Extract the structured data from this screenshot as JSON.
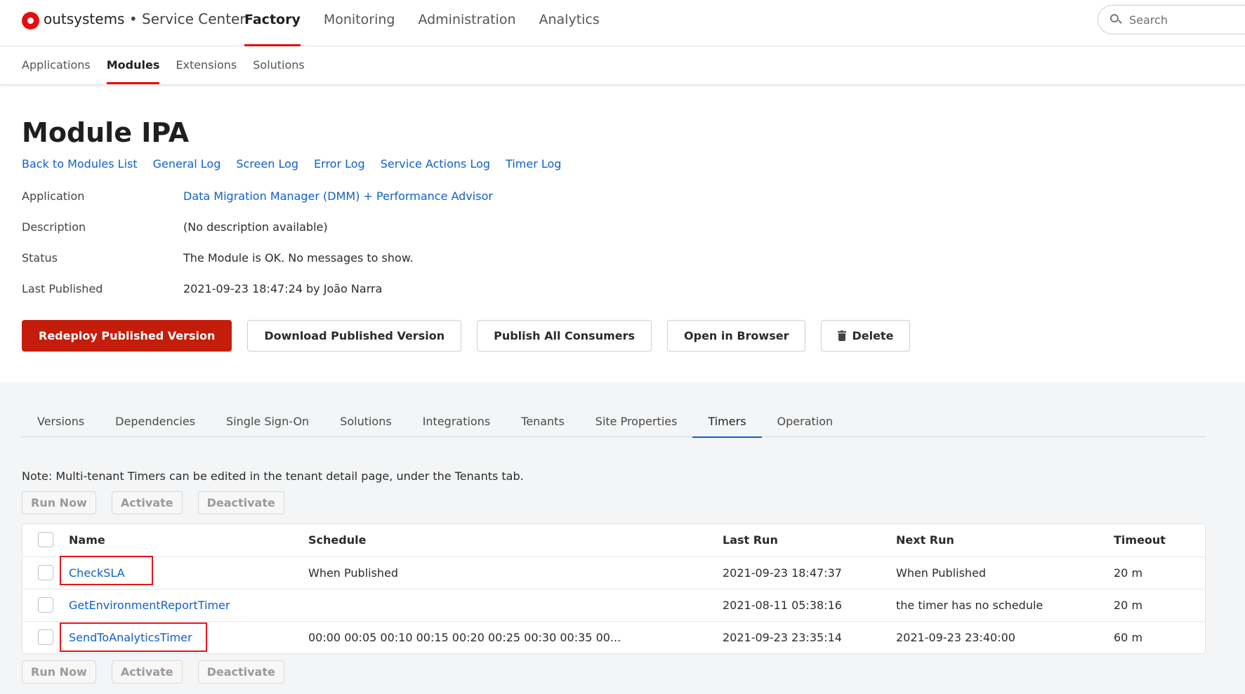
{
  "header": {
    "brand": "outsystems",
    "separator": "•",
    "product": "Service Center",
    "nav": [
      "Factory",
      "Monitoring",
      "Administration",
      "Analytics"
    ],
    "nav_active": "Factory",
    "search_placeholder": "Search",
    "brand_color": "#e40e0e"
  },
  "subnav": {
    "items": [
      "Applications",
      "Modules",
      "Extensions",
      "Solutions"
    ],
    "active": "Modules"
  },
  "page": {
    "title": "Module IPA",
    "links": [
      "Back to Modules List",
      "General Log",
      "Screen Log",
      "Error Log",
      "Service Actions Log",
      "Timer Log"
    ]
  },
  "info": {
    "application_label": "Application",
    "application_value": "Data Migration Manager (DMM) + Performance Advisor",
    "description_label": "Description",
    "description_value": "(No description available)",
    "status_label": "Status",
    "status_value": "The Module is OK. No messages to show.",
    "last_published_label": "Last Published",
    "last_published_value": "2021-09-23 18:47:24  by  João Narra"
  },
  "actions": {
    "redeploy": "Redeploy Published Version",
    "download": "Download Published Version",
    "publish_consumers": "Publish All Consumers",
    "open_browser": "Open in Browser",
    "delete": "Delete",
    "primary_color": "#c51d0b"
  },
  "tabs": {
    "items": [
      "Versions",
      "Dependencies",
      "Single Sign-On",
      "Solutions",
      "Integrations",
      "Tenants",
      "Site Properties",
      "Timers",
      "Operation"
    ],
    "active": "Timers"
  },
  "timers": {
    "note": "Note: Multi-tenant Timers can be edited in the tenant detail page, under the Tenants tab.",
    "buttons": [
      "Run Now",
      "Activate",
      "Deactivate"
    ],
    "columns": [
      "Name",
      "Schedule",
      "Last Run",
      "Next Run",
      "Timeout"
    ],
    "rows": [
      {
        "name": "CheckSLA",
        "schedule": "When Published",
        "last_run": "2021-09-23 18:47:37",
        "next_run": "When Published",
        "timeout": "20 m"
      },
      {
        "name": "GetEnvironmentReportTimer",
        "schedule": "",
        "last_run": "2021-08-11 05:38:16",
        "next_run": "the timer has no schedule",
        "timeout": "20 m"
      },
      {
        "name": "SendToAnalyticsTimer",
        "schedule": "00:00 00:05 00:10 00:15 00:20 00:25 00:30 00:35 00...",
        "last_run": "2021-09-23 23:35:14",
        "next_run": "2021-09-23 23:40:00",
        "timeout": "60 m"
      }
    ],
    "highlight_color": "#e6141b"
  }
}
